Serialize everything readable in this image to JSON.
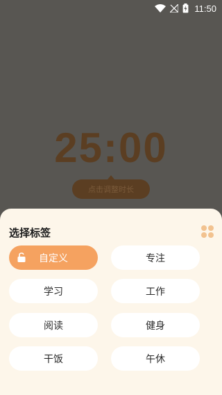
{
  "status_bar": {
    "time": "11:50",
    "icons": [
      "wifi-icon",
      "signal-off-icon",
      "battery-charging-icon"
    ]
  },
  "timer": {
    "display": "25:00",
    "adjust_hint": "点击调整时长"
  },
  "tag_sheet": {
    "title": "选择标签",
    "menu_icon": "grid-dots-icon",
    "selected": "自定义",
    "tags": [
      {
        "label": "自定义",
        "icon": "unlock-icon",
        "active": true
      },
      {
        "label": "专注",
        "active": false
      },
      {
        "label": "学习",
        "active": false
      },
      {
        "label": "工作",
        "active": false
      },
      {
        "label": "阅读",
        "active": false
      },
      {
        "label": "健身",
        "active": false
      },
      {
        "label": "干饭",
        "active": false
      },
      {
        "label": "午休",
        "active": false
      }
    ]
  },
  "colors": {
    "overlay": "#585652",
    "sheet_bg": "#fdf6ea",
    "accent": "#f5a260",
    "timer_text": "#5b3e22"
  }
}
